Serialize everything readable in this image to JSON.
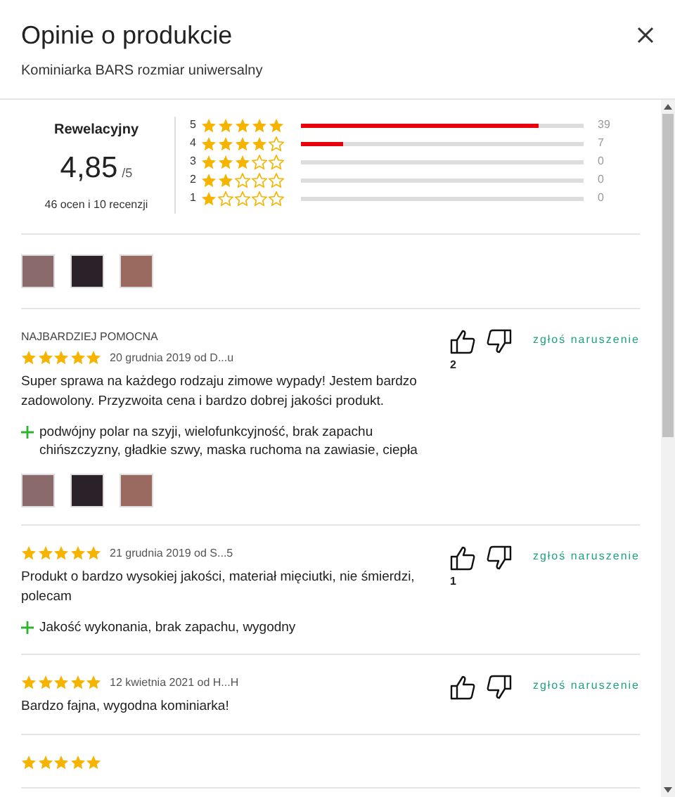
{
  "dialog": {
    "title": "Opinie o produkcie",
    "subtitle": "Kominiarka BARS rozmiar uniwersalny"
  },
  "summary": {
    "label": "Rewelacyjny",
    "score": "4,85",
    "scale": "/5",
    "count_text": "46 ocen i 10 recenzji"
  },
  "distribution": [
    {
      "label": "5",
      "stars": 5,
      "level": 0.84,
      "count": "39"
    },
    {
      "label": "4",
      "stars": 4,
      "level": 0.15,
      "count": "7"
    },
    {
      "label": "3",
      "stars": 3,
      "level": 0,
      "count": "0"
    },
    {
      "label": "2",
      "stars": 2,
      "level": 0,
      "count": "0"
    },
    {
      "label": "1",
      "stars": 1,
      "level": 0,
      "count": "0"
    }
  ],
  "gallery": [
    {
      "color": "#8a6a6a"
    },
    {
      "color": "#2a2228"
    },
    {
      "color": "#9a6a60"
    }
  ],
  "reviews": [
    {
      "badge": "NAJBARDZIEJ POMOCNA",
      "stars": 5,
      "meta": "20 grudnia 2019 od D...u",
      "text": "Super sprawa na każdego rodzaju zimowe wypady! Jestem bardzo zadowolony. Przyzwoita cena i bardzo dobrej jakości produkt.",
      "pros": [
        "podwójny polar na szyji, wielofunkcyjność, brak zapachu chińszczyzny, gładkie szwy, maska ruchoma na zawiasie, ciepła"
      ],
      "photos": [
        {
          "color": "#8a6a6a"
        },
        {
          "color": "#2a2228"
        },
        {
          "color": "#9a6a60"
        }
      ],
      "likes": "2",
      "report": "zgłoś naruszenie"
    },
    {
      "stars": 5,
      "meta": "21 grudnia 2019 od S...5",
      "text": "Produkt o bardzo wysokiej jakości, materiał mięciutki, nie śmierdzi, polecam",
      "pros": [
        "Jakość wykonania, brak zapachu, wygodny"
      ],
      "likes": "1",
      "report": "zgłoś naruszenie"
    },
    {
      "stars": 5,
      "meta": "12 kwietnia 2021 od H...H",
      "text": "Bardzo fajna, wygodna kominiarka!",
      "report": "zgłoś naruszenie"
    },
    {
      "stars": 5
    }
  ]
}
